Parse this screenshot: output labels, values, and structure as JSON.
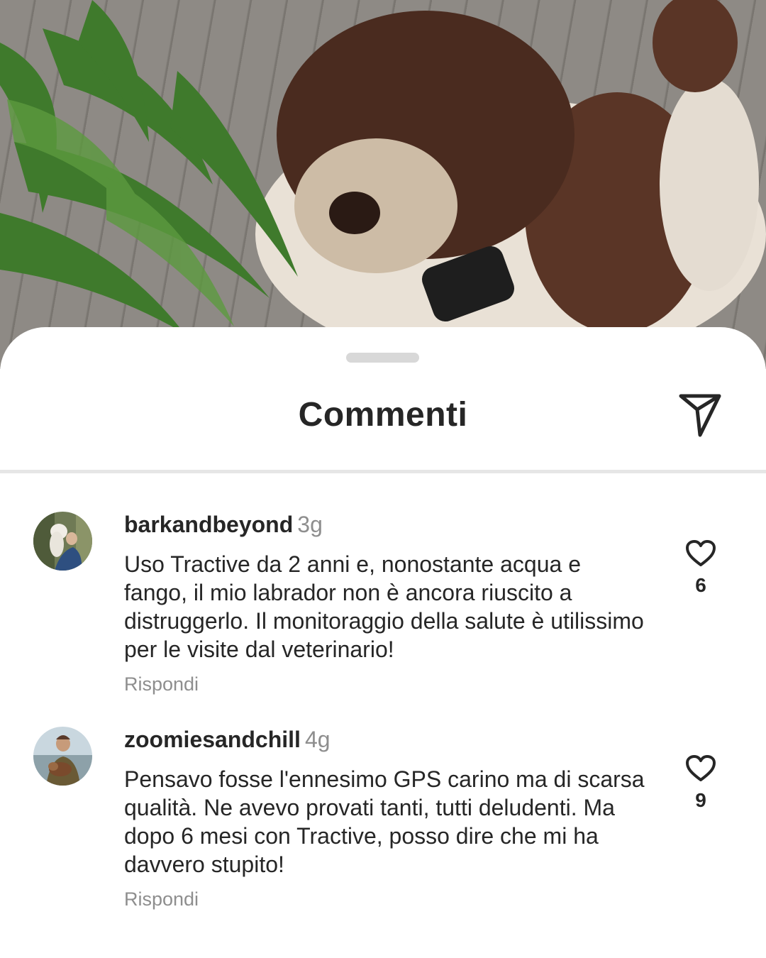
{
  "sheet": {
    "title": "Commenti"
  },
  "icons": {
    "share": "send-paper-plane-icon",
    "like": "heart-outline-icon",
    "grabber": "drag-handle"
  },
  "comments": [
    {
      "username": "barkandbeyond",
      "time": "3g",
      "text": "Uso Tractive da 2 anni e, nonostante acqua e fango, il mio labrador non è ancora riuscito a distruggerlo. Il monitoraggio della salute è utilissimo per le visite dal veterinario!",
      "reply_label": "Rispondi",
      "likes": "6"
    },
    {
      "username": "zoomiesandchill",
      "time": "4g",
      "text": "Pensavo fosse l'ennesimo GPS carino ma di scarsa qualità. Ne avevo provati tanti, tutti deludenti. Ma dopo 6 mesi con Tractive, posso dire che mi ha davvero stupito!",
      "reply_label": "Rispondi",
      "likes": "9"
    }
  ]
}
